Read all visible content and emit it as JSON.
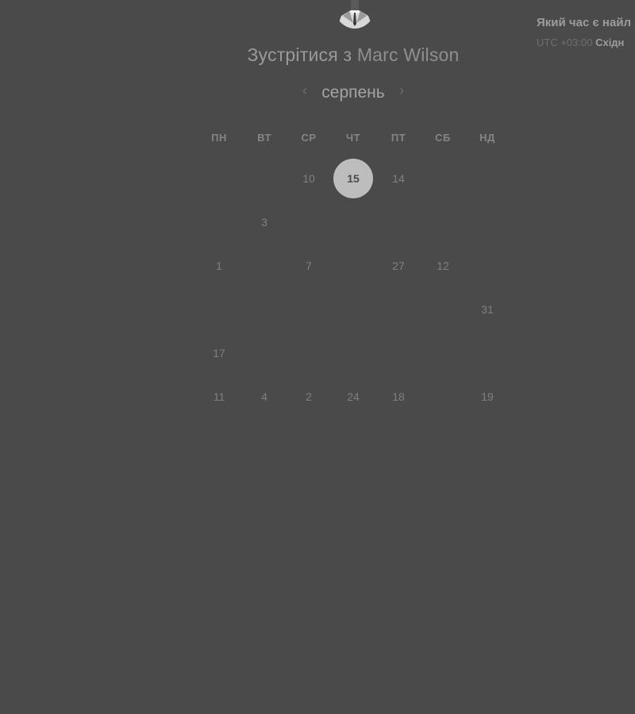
{
  "header": {
    "title_prefix": "Зустрітися з",
    "host_name": "Marc Wilson"
  },
  "calendar": {
    "month": "серпень",
    "prev_icon": "chevron-left-icon",
    "next_icon": "chevron-right-icon",
    "weekdays": [
      "ПН",
      "ВТ",
      "СР",
      "ЧТ",
      "ПТ",
      "СБ",
      "НД"
    ],
    "rows": [
      [
        {
          "label": "",
          "state": "faint"
        },
        {
          "label": "",
          "state": "faint"
        },
        {
          "label": "10",
          "state": "normal"
        },
        {
          "label": "15",
          "state": "selected"
        },
        {
          "label": "14",
          "state": "normal"
        },
        {
          "label": "",
          "state": "faint"
        },
        {
          "label": "",
          "state": "faint"
        }
      ],
      [
        {
          "label": "",
          "state": "faint"
        },
        {
          "label": "3",
          "state": "normal"
        },
        {
          "label": "",
          "state": "faint"
        },
        {
          "label": "",
          "state": "faint"
        },
        {
          "label": "",
          "state": "faint"
        },
        {
          "label": "",
          "state": "faint"
        },
        {
          "label": "",
          "state": "faint"
        }
      ],
      [
        {
          "label": "1",
          "state": "normal"
        },
        {
          "label": "",
          "state": "faint"
        },
        {
          "label": "7",
          "state": "normal"
        },
        {
          "label": "",
          "state": "faint"
        },
        {
          "label": "27",
          "state": "normal"
        },
        {
          "label": "12",
          "state": "normal"
        },
        {
          "label": "",
          "state": "faint"
        }
      ],
      [
        {
          "label": "",
          "state": "faint"
        },
        {
          "label": "",
          "state": "faint"
        },
        {
          "label": "",
          "state": "faint"
        },
        {
          "label": "",
          "state": "faint"
        },
        {
          "label": "",
          "state": "faint"
        },
        {
          "label": "",
          "state": "faint"
        },
        {
          "label": "31",
          "state": "normal"
        }
      ],
      [
        {
          "label": "17",
          "state": "normal"
        },
        {
          "label": "",
          "state": "faint"
        },
        {
          "label": "",
          "state": "faint"
        },
        {
          "label": "",
          "state": "faint"
        },
        {
          "label": "",
          "state": "faint"
        },
        {
          "label": "",
          "state": "faint"
        },
        {
          "label": "",
          "state": "faint"
        }
      ],
      [
        {
          "label": "11",
          "state": "normal"
        },
        {
          "label": "4",
          "state": "normal"
        },
        {
          "label": "2",
          "state": "normal"
        },
        {
          "label": "24",
          "state": "normal"
        },
        {
          "label": "18",
          "state": "normal"
        },
        {
          "label": "",
          "state": "faint"
        },
        {
          "label": "19",
          "state": "normal"
        }
      ]
    ]
  },
  "side_panel": {
    "question": "Який час є найл",
    "utc_offset": "UTC +03:00",
    "timezone_name": "Східн"
  },
  "colors": {
    "background": "#4a4a4a",
    "selected_day": "#bdbdbd"
  }
}
